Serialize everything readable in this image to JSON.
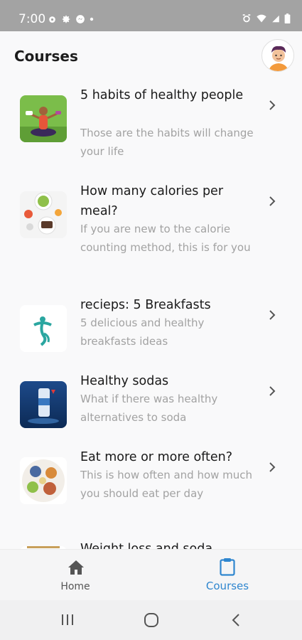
{
  "status_bar": {
    "time": "7:00",
    "left_icons": [
      "settings-icon",
      "gear-icon",
      "messenger-icon",
      "dot-icon"
    ],
    "right_icons": [
      "alarm-icon",
      "wifi-icon",
      "signal-icon",
      "battery-icon"
    ]
  },
  "header": {
    "title": "Courses",
    "avatar_icon": "user-avatar-icon"
  },
  "courses": [
    {
      "title": "5 habits of healthy people",
      "description": "Those are the habits will change your life",
      "thumbnail": "yoga-woman-thumbnail"
    },
    {
      "title": "How many calories per meal?",
      "description": "If you are new to the calorie counting method, this is for you",
      "thumbnail": "meal-plates-thumbnail"
    },
    {
      "title": "recieps: 5 Breakfasts",
      "description": "5 delicious and healthy breakfasts ideas",
      "thumbnail": "dancer-logo-thumbnail"
    },
    {
      "title": "Healthy sodas",
      "description": "What if there was healthy alternatives to soda",
      "thumbnail": "soda-can-thumbnail"
    },
    {
      "title": "Eat more or more often?",
      "description": "This is how often and how much you should eat per day",
      "thumbnail": "food-platter-thumbnail"
    },
    {
      "title": "Weight loss and soda",
      "description": "",
      "thumbnail": "partial-thumbnail"
    }
  ],
  "bottom_nav": {
    "home_label": "Home",
    "courses_label": "Courses",
    "active": "Courses"
  },
  "colors": {
    "accent": "#2f86cf",
    "inactive": "#555555",
    "status_bar": "#a3a3a3"
  },
  "system_nav": [
    "recent-apps-icon",
    "home-circle-icon",
    "back-icon"
  ]
}
